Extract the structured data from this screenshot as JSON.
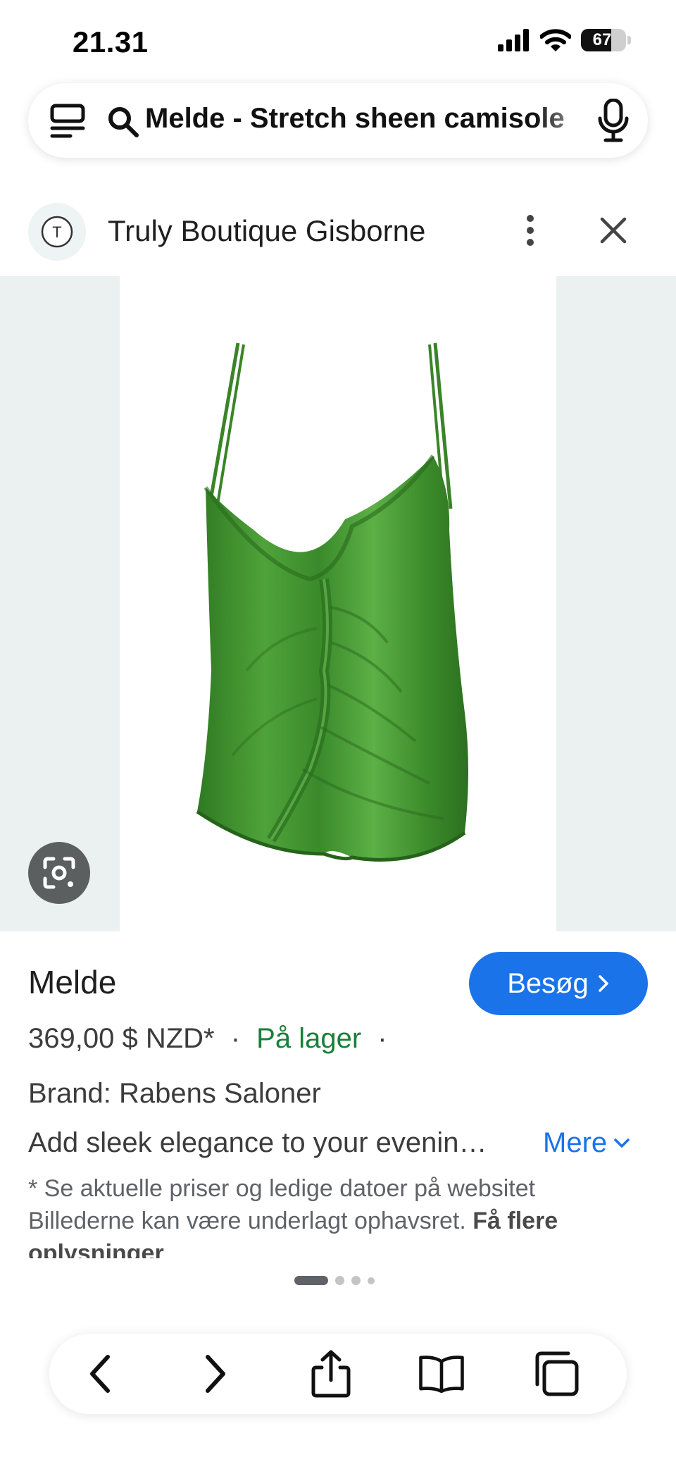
{
  "status_bar": {
    "time": "21.31",
    "battery": "67"
  },
  "search": {
    "query": "Melde - Stretch sheen camisole"
  },
  "source": {
    "logo_letter": "T",
    "name": "Truly Boutique Gisborne"
  },
  "product": {
    "title": "Melde",
    "visit_label": "Besøg",
    "price": "369,00 $ NZD*",
    "separator": "·",
    "stock": "På lager",
    "brand": "Brand: Rabens Saloner",
    "description": "Add sleek elegance to your evenin…",
    "more_label": "Mere",
    "disclaimer_main": "* Se aktuelle priser og ledige datoer på websitet Billederne kan være underlagt ophavsret.",
    "disclaimer_bold": "Få flere oplysninger"
  },
  "carousel": {
    "pages": 4,
    "current": 1
  },
  "colors": {
    "accent": "#1a73e8",
    "stock_green": "#188038",
    "garment_green": "#3f8f2c",
    "image_bg": "#ebf1f1"
  },
  "icons": [
    "tab-list-icon",
    "search-icon",
    "microphone-icon",
    "kebab-menu-icon",
    "close-icon",
    "lens-icon",
    "chevron-right-icon",
    "chevron-down-icon",
    "back-icon",
    "forward-icon",
    "share-icon",
    "bookmarks-icon",
    "tabs-icon",
    "signal-icon",
    "wifi-icon"
  ]
}
